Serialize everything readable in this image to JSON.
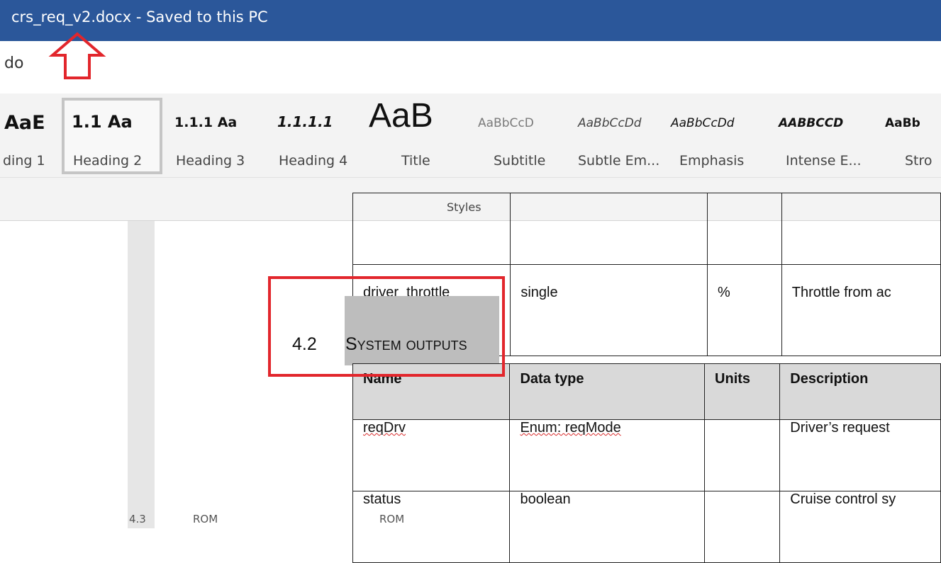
{
  "window": {
    "title": "crs_req_v2.docx  -  Saved to this PC"
  },
  "toolbar": {
    "undo_label": "do"
  },
  "styles_gallery": {
    "group_label": "Styles",
    "items": [
      {
        "preview": "AaE",
        "label": "ding 1"
      },
      {
        "preview": "1.1  Aa",
        "label": "Heading 2",
        "selected": true
      },
      {
        "preview": "1.1.1  Aa",
        "label": "Heading 3"
      },
      {
        "preview": "1.1.1.1",
        "label": "Heading 4"
      },
      {
        "preview": "AaB",
        "label": "Title"
      },
      {
        "preview": "AaBbCcD",
        "label": "Subtitle"
      },
      {
        "preview": "AaBbCcDd",
        "label": "Subtle Em..."
      },
      {
        "preview": "AaBbCcDd",
        "label": "Emphasis"
      },
      {
        "preview": "AABBCCD",
        "label": "Intense E..."
      },
      {
        "preview": "AaBb",
        "label": "Stro"
      }
    ]
  },
  "document": {
    "inputs_table": {
      "rows": [
        {
          "name": "",
          "type": "",
          "units": "",
          "desc": ""
        },
        {
          "name": "driver_throttle",
          "type": "single",
          "units": "%",
          "desc": "Throttle from ac"
        }
      ]
    },
    "heading": {
      "number": "4.2",
      "text": "System outputs"
    },
    "outputs_table": {
      "headers": [
        "Name",
        "Data type",
        "Units",
        "Description"
      ],
      "rows": [
        {
          "name": "reqDrv",
          "type": "Enum: reqMode",
          "units": "",
          "desc": "Driver’s request"
        },
        {
          "name": "status",
          "type": "boolean",
          "units": "",
          "desc": "Cruise control sy"
        }
      ]
    },
    "bottom_fragments": {
      "a": "4.3",
      "b": "ROM",
      "c": "ROM"
    }
  },
  "colors": {
    "titlebar": "#2b579a",
    "annotation_red": "#e2262c",
    "ribbon": "#f3f3f3"
  }
}
